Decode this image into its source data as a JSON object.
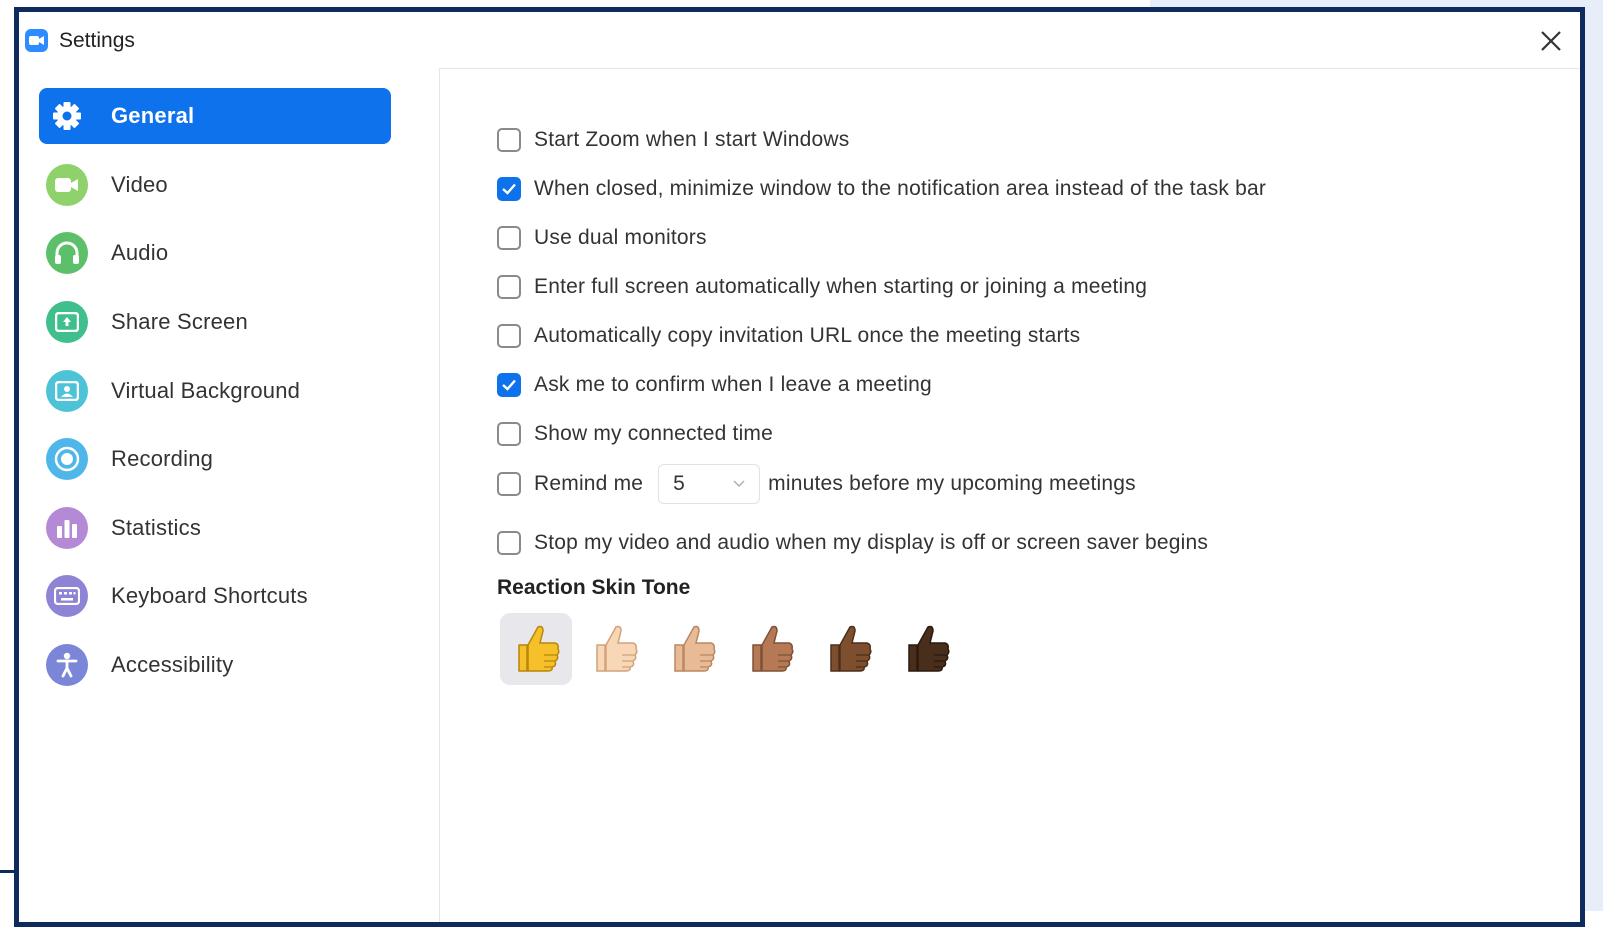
{
  "window": {
    "title": "Settings"
  },
  "sidebar": {
    "items": [
      {
        "label": "General",
        "icon": "gear-icon",
        "color": "#0e72ed",
        "active": true
      },
      {
        "label": "Video",
        "icon": "video-camera-icon",
        "color": "#8fd16a"
      },
      {
        "label": "Audio",
        "icon": "headphones-icon",
        "color": "#5cc06b"
      },
      {
        "label": "Share Screen",
        "icon": "share-screen-icon",
        "color": "#3fbf8c"
      },
      {
        "label": "Virtual Background",
        "icon": "person-portrait-icon",
        "color": "#4ec3d8"
      },
      {
        "label": "Recording",
        "icon": "record-icon",
        "color": "#4fb6ea"
      },
      {
        "label": "Statistics",
        "icon": "bar-chart-icon",
        "color": "#b48ad6"
      },
      {
        "label": "Keyboard Shortcuts",
        "icon": "keyboard-icon",
        "color": "#8d84d6"
      },
      {
        "label": "Accessibility",
        "icon": "accessibility-icon",
        "color": "#7b86d8"
      }
    ]
  },
  "general": {
    "options": [
      {
        "label": "Start Zoom when I start Windows",
        "checked": false
      },
      {
        "label": "When closed, minimize window to the notification area instead of the task bar",
        "checked": true
      },
      {
        "label": "Use dual monitors",
        "checked": false
      },
      {
        "label": "Enter full screen automatically when starting or joining a meeting",
        "checked": false
      },
      {
        "label": "Automatically copy invitation URL once the meeting starts",
        "checked": false
      },
      {
        "label": "Ask me to confirm when I leave a meeting",
        "checked": true
      },
      {
        "label": "Show my connected time",
        "checked": false
      }
    ],
    "remind": {
      "checked": false,
      "label_before": "Remind me",
      "minutes_value": "5",
      "label_after": "minutes before my upcoming meetings"
    },
    "stop_video": {
      "label": "Stop my video and audio when my display is off or screen saver begins",
      "checked": false
    },
    "reaction_skin_tone": {
      "title": "Reaction Skin Tone",
      "tones": [
        "#f5c02a",
        "#f7d7b5",
        "#e8bb96",
        "#b57a55",
        "#7d4f2e",
        "#4a2e1c"
      ],
      "selected_index": 0
    }
  },
  "colors": {
    "accent": "#0e72ed",
    "frame": "#0f2a5c"
  }
}
